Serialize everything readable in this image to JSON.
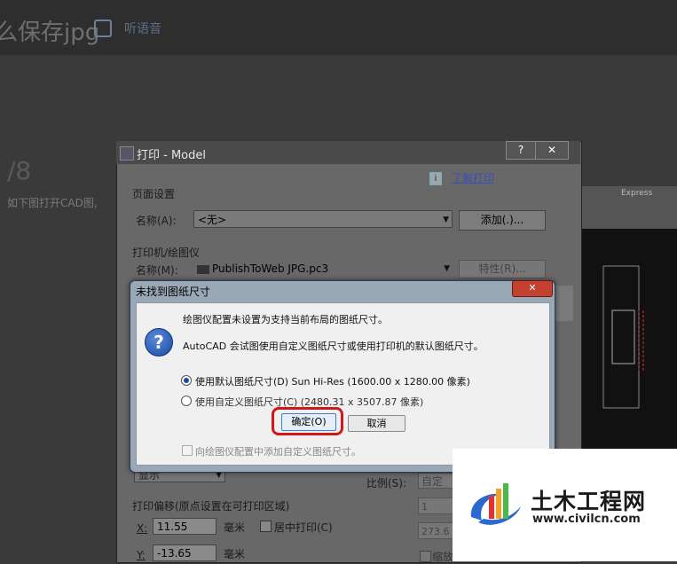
{
  "background": {
    "title": "么保存jpg",
    "read_label": "听语音",
    "step_number": "/8",
    "paragraph": "如下图打开CAD图,"
  },
  "cad": {
    "toolbar_label": "Express"
  },
  "print_dialog": {
    "title": "打印 - Model",
    "help_label": "?",
    "close_label": "✕",
    "learn_icon": "i",
    "learn_link": "了解打印",
    "page_setup": {
      "group_label": "页面设置",
      "name_label": "名称(A):",
      "name_value": "<无>",
      "add_button": "添加(.)..."
    },
    "printer": {
      "group_label": "打印机/绘图仪",
      "name_label": "名称(M):",
      "name_value": "PublishToWeb JPG.pc3",
      "properties_button": "特性(R)..."
    },
    "display_value": "显示",
    "offset": {
      "group_label": "打印偏移(原点设置在可打印区域)",
      "x_label": "X:",
      "x_value": "11.55",
      "y_label": "Y:",
      "y_value": "-13.65",
      "unit": "毫米",
      "center_label": "居中打印(C)"
    },
    "scale": {
      "label": "比例(S):",
      "value": "自定义",
      "value1": "1",
      "value2": "273.6",
      "shrink_label": "缩放"
    }
  },
  "alert_dialog": {
    "title": "未找到图纸尺寸",
    "close_label": "✕",
    "icon": "?",
    "line1": "绘图仪配置未设置为支持当前布局的图纸尺寸。",
    "line2": "AutoCAD 会试图使用自定义图纸尺寸或使用打印机的默认图纸尺寸。",
    "option_default": "使用默认图纸尺寸(D)  Sun Hi-Res (1600.00 x 1280.00 像素)",
    "option_custom": "使用自定义图纸尺寸(C)   (2480.31 x 3507.87 像素)",
    "ok_button": "确定(O)",
    "cancel_button": "取消",
    "add_custom_label": "向绘图仪配置中添加自定义图纸尺寸。"
  },
  "watermark": {
    "name": "土木工程网",
    "url": "www.civilcn.com"
  }
}
